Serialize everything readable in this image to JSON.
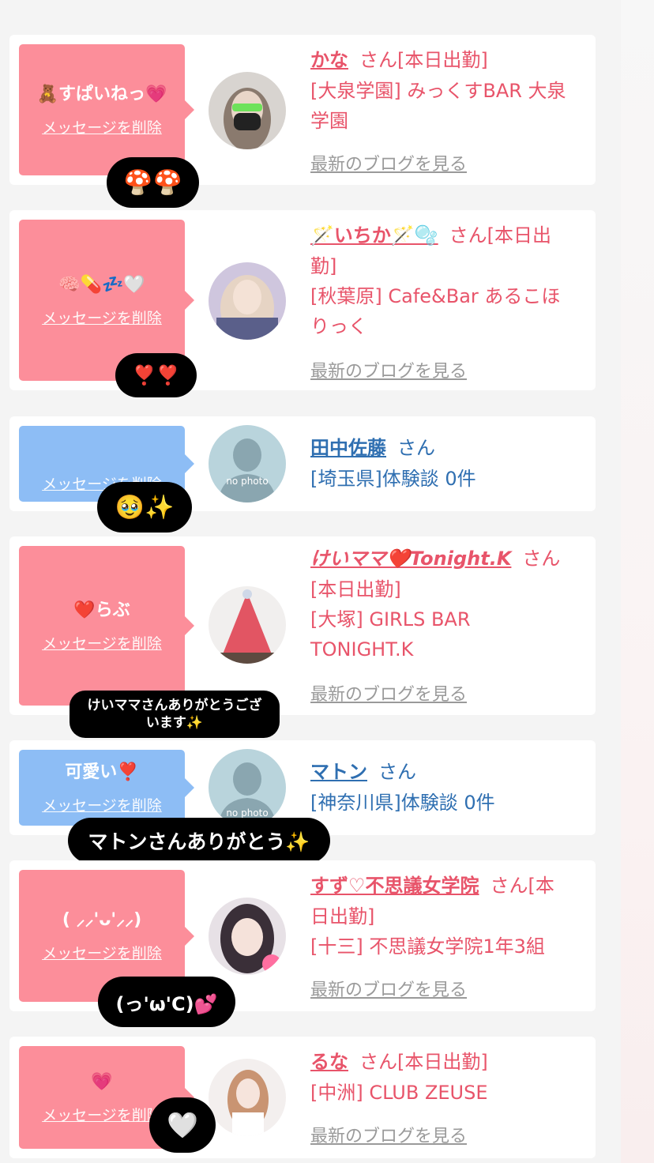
{
  "colors": {
    "bubble_pink": "#fc8e9a",
    "bubble_blue": "#8dbdf5",
    "name_pink": "#e8546a",
    "name_blue": "#2f6fb1",
    "blog_gray": "#9a9a9a"
  },
  "common": {
    "delete_label": "メッセージを削除",
    "blog_label": "最新のブログを見る"
  },
  "messages": [
    {
      "bubble_text": "🧸すぱいねっ💗",
      "name": "かな",
      "suffix": "さん[本日出勤]",
      "shop_line1": "[大泉学園] みっくすBAR 大泉",
      "shop_line2": "学園",
      "reaction": "🍄🍄"
    },
    {
      "bubble_text": "🧠💊💤🤍",
      "name": "🪄いちか🪄🫧",
      "suffix": "さん[本日出",
      "suffix2": "勤]",
      "shop_line1": "[秋葉原] Cafe&Bar あるこほ",
      "shop_line2": "りっく",
      "reaction": "❣️❣️"
    },
    {
      "bubble_text": "",
      "name": "田中佐藤",
      "suffix": "さん",
      "shop_line1": "[埼玉県]体験談 0件",
      "avatar_label": "no photo",
      "reaction": "🥹✨"
    },
    {
      "bubble_text": "❤️らぶ",
      "name": "けいママ❤️Tonight.K",
      "suffix": "さん",
      "shop_line1": "[本日出勤]",
      "shop_line2": "[大塚] GIRLS BAR",
      "shop_line3": "TONIGHT.K",
      "reaction_line1": "けいママさんありがとうござ",
      "reaction_line2": "います✨"
    },
    {
      "bubble_text": "可愛い❣️",
      "name": "マトン",
      "suffix": "さん",
      "shop_line1": "[神奈川県]体験談 0件",
      "avatar_label": "no photo",
      "reaction": "マトンさんありがとう✨"
    },
    {
      "bubble_text": "( ⸝⸝'ᴗ'⸝⸝)",
      "name": "すず♡不思議女学院",
      "suffix": "さん[本",
      "suffix2": "日出勤]",
      "shop_line1": "[十三] 不思議女学院1年3組",
      "reaction": "(っ'ω'C)💕"
    },
    {
      "bubble_text": "💗",
      "name": "るな",
      "suffix": "さん[本日出勤]",
      "shop_line1": "[中洲] CLUB ZEUSE",
      "reaction": "🤍"
    }
  ]
}
